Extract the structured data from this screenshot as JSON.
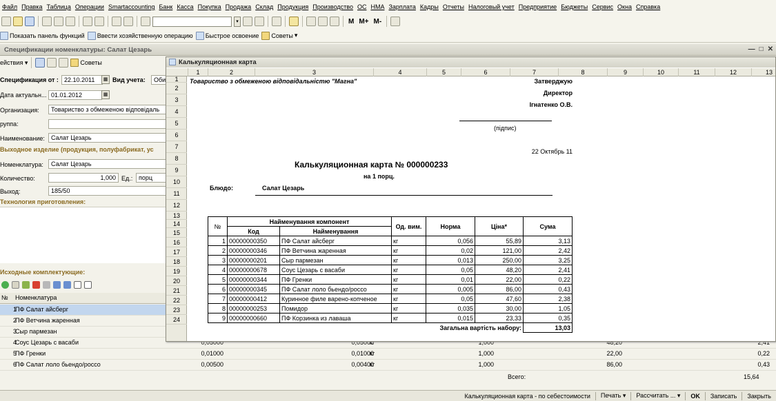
{
  "menu": [
    "Файл",
    "Правка",
    "Таблица",
    "Операции",
    "Smartaccounting",
    "Банк",
    "Касса",
    "Покупка",
    "Продажа",
    "Склад",
    "Продукция",
    "Производство",
    "ОС",
    "НМА",
    "Зарплата",
    "Кадры",
    "Отчеты",
    "Налоговый учет",
    "Предприятие",
    "Бюджеты",
    "Сервис",
    "Окна",
    "Справка"
  ],
  "toolbar": {
    "m_label": "M",
    "mplus_label": "M+",
    "mminus_label": "M-"
  },
  "toolbar2": {
    "show_panel": "Показать панель функций",
    "enter_op": "Ввести хозяйственную операцию",
    "quick": "Быстрое освоение",
    "tips": "Советы"
  },
  "spec_window": {
    "title": "Спецификации номенклатуры: Салат Цезарь",
    "actions": "ействия",
    "tips": "Советы",
    "spec_from_label": "Спецификация от :",
    "spec_from_value": "22.10.2011",
    "view_label": "Вид учета:",
    "view_value": "Оби",
    "date_label": "Дата актуальн...",
    "date_value": "01.01.2012",
    "org_label": "Организация:",
    "org_value": "Товариство з обмеженою відповідаль",
    "group_label": "руппа:",
    "group_value": "",
    "name_label": "Наименование:",
    "name_value": "Салат Цезарь",
    "output_section": "Выходное изделие (продукция, полуфабрикат, ус",
    "nom_label": "Номенклатура:",
    "nom_value": "Салат Цезарь",
    "qty_label": "Количество:",
    "qty_value": "1,000",
    "unit_label": "Ед.:",
    "unit_value": "порц",
    "yield_label": "Выход:",
    "yield_value": "185/50",
    "tech_section": "Технология приготовления:",
    "components_section": "Исходные комплектующие:",
    "table_headers": {
      "num": "№",
      "nom": "Номенклатура"
    },
    "rows": [
      {
        "n": "1",
        "name": "ПФ Салат айсберг",
        "qty1": "",
        "qty2": "",
        "unit": "",
        "coef": "",
        "price": "",
        "sum": ""
      },
      {
        "n": "2",
        "name": "ПФ Ветчина жаренная",
        "qty1": "",
        "qty2": "",
        "unit": "",
        "coef": "",
        "price": "",
        "sum": ""
      },
      {
        "n": "3",
        "name": "Сыр пармезан",
        "qty1": "",
        "qty2": "",
        "unit": "",
        "coef": "",
        "price": "",
        "sum": ""
      },
      {
        "n": "4",
        "name": "Соус Цезарь с васаби",
        "qty1": "0,05000",
        "qty2": "0,05000",
        "unit": "кг",
        "coef": "1,000",
        "price": "48,20",
        "sum": "2,41"
      },
      {
        "n": "5",
        "name": "ПФ Гренки",
        "qty1": "0,01000",
        "qty2": "0,01000",
        "unit": "кг",
        "coef": "1,000",
        "price": "22,00",
        "sum": "0,22"
      },
      {
        "n": "6",
        "name": "ПФ Салат лоло бьендо/россо",
        "qty1": "0,00500",
        "qty2": "0,00400",
        "unit": "кг",
        "coef": "1,000",
        "price": "86,00",
        "sum": "0,43"
      }
    ],
    "total_label": "Всего:",
    "total_value": "15,64"
  },
  "calc_card": {
    "window_title": "Калькуляционная карта",
    "col_numbers": [
      "1",
      "2",
      "3",
      "4",
      "5",
      "6",
      "7",
      "8",
      "9",
      "10",
      "11",
      "12",
      "13"
    ],
    "row_numbers": [
      "1",
      "2",
      "3",
      "4",
      "5",
      "6",
      "7",
      "8",
      "9",
      "10",
      "11",
      "12",
      "13",
      "14",
      "15",
      "16",
      "17",
      "18",
      "19",
      "20",
      "21",
      "22",
      "23",
      "24"
    ],
    "company": "Товариство з обмеженою відповідальністю \"Магна\"",
    "approve": "Затверджую",
    "director": "Директор",
    "director_name": "Ігнатенко О.В.",
    "sign_caption": "(підпис)",
    "date": "22 Октябрь 11",
    "doc_title": "Калькуляционная карта № 000000233",
    "per_portion": "на 1 порц.",
    "dish_label": "Блюдо:",
    "dish_name": "Салат Цезарь",
    "headers": {
      "num": "№",
      "component": "Найменування компонент",
      "code": "Код",
      "name": "Найменування",
      "unit": "Од. вим.",
      "norm": "Норма",
      "price": "Ціна*",
      "sum": "Сума"
    },
    "items": [
      {
        "n": "1",
        "code": "00000000350",
        "name": "ПФ Салат айсберг",
        "unit": "кг",
        "norm": "0,056",
        "price": "55,89",
        "sum": "3,13"
      },
      {
        "n": "2",
        "code": "00000000346",
        "name": "ПФ Ветчина жаренная",
        "unit": "кг",
        "norm": "0,02",
        "price": "121,00",
        "sum": "2,42"
      },
      {
        "n": "3",
        "code": "00000000201",
        "name": "Сыр пармезан",
        "unit": "кг",
        "norm": "0,013",
        "price": "250,00",
        "sum": "3,25"
      },
      {
        "n": "4",
        "code": "00000000678",
        "name": "Соус Цезарь с васаби",
        "unit": "кг",
        "norm": "0,05",
        "price": "48,20",
        "sum": "2,41"
      },
      {
        "n": "5",
        "code": "00000000344",
        "name": "ПФ Гренки",
        "unit": "кг",
        "norm": "0,01",
        "price": "22,00",
        "sum": "0,22"
      },
      {
        "n": "6",
        "code": "00000000345",
        "name": "ПФ Салат лоло бьендо/россо",
        "unit": "кг",
        "norm": "0,005",
        "price": "86,00",
        "sum": "0,43"
      },
      {
        "n": "7",
        "code": "00000000412",
        "name": "Куринное филе варено-копченое",
        "unit": "кг",
        "norm": "0,05",
        "price": "47,60",
        "sum": "2,38"
      },
      {
        "n": "8",
        "code": "00000000253",
        "name": "Помидор",
        "unit": "кг",
        "norm": "0,035",
        "price": "30,00",
        "sum": "1,05"
      },
      {
        "n": "9",
        "code": "00000000660",
        "name": "ПФ Корзинка из лаваша",
        "unit": "кг",
        "norm": "0,015",
        "price": "23,33",
        "sum": "0,35"
      }
    ],
    "total_label": "Загальна вартість набору:",
    "total_value": "13,03"
  },
  "statusbar": {
    "calc": "Калькуляционная карта - по себестоимости",
    "print": "Печать",
    "calc_btn": "Рассчитать ...",
    "ok": "OK",
    "save": "Записать",
    "close": "Закрыть"
  }
}
